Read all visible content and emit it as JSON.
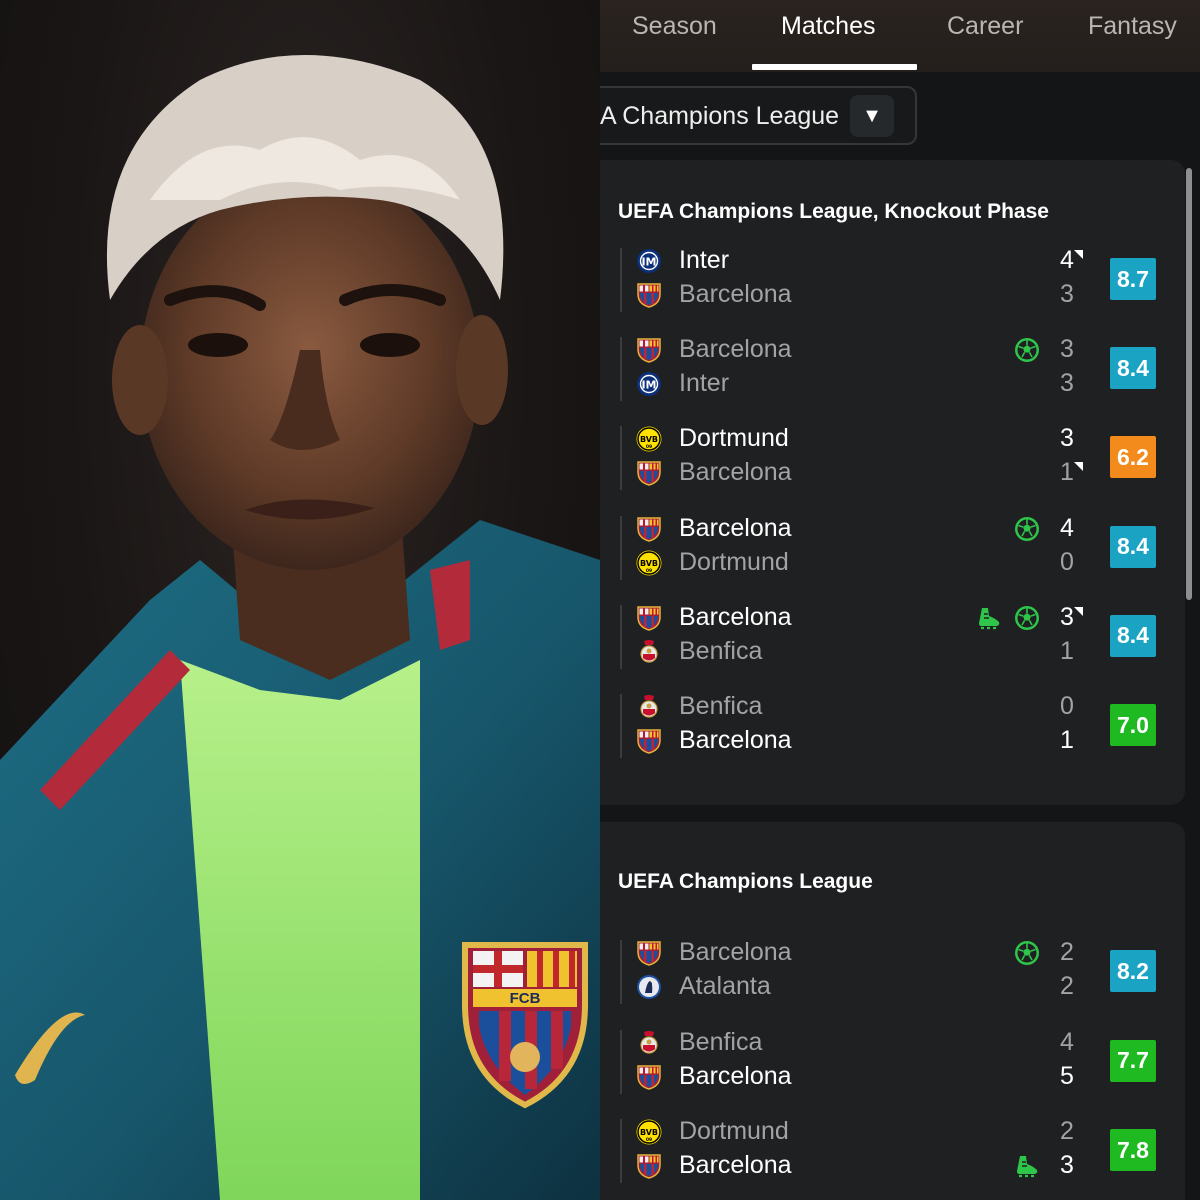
{
  "tabs": [
    {
      "label": "Season"
    },
    {
      "label": "Matches"
    },
    {
      "label": "Career"
    },
    {
      "label": "Fantasy"
    }
  ],
  "active_tab": "Matches",
  "league_select": {
    "value": "A Champions League"
  },
  "sections": [
    {
      "title": "UEFA Champions League, Knockout Phase",
      "matches": [
        {
          "home": {
            "name": "Inter",
            "logo": "inter-icon",
            "score": "4",
            "penalty_mark": true
          },
          "away": {
            "name": "Barcelona",
            "logo": "barcelona-icon",
            "score": "3"
          },
          "events": [],
          "rating": "8.7",
          "rating_color": "#1aa3c2"
        },
        {
          "home": {
            "name": "Barcelona",
            "logo": "barcelona-icon",
            "score": "3"
          },
          "away": {
            "name": "Inter",
            "logo": "inter-icon",
            "score": "3"
          },
          "events": [
            "goal-icon"
          ],
          "rating": "8.4",
          "rating_color": "#1aa3c2"
        },
        {
          "home": {
            "name": "Dortmund",
            "logo": "dortmund-icon",
            "score": "3"
          },
          "away": {
            "name": "Barcelona",
            "logo": "barcelona-icon",
            "score": "1",
            "penalty_mark": true
          },
          "events": [],
          "rating": "6.2",
          "rating_color": "#f28a1c"
        },
        {
          "home": {
            "name": "Barcelona",
            "logo": "barcelona-icon",
            "score": "4"
          },
          "away": {
            "name": "Dortmund",
            "logo": "dortmund-icon",
            "score": "0"
          },
          "events": [
            "goal-icon"
          ],
          "rating": "8.4",
          "rating_color": "#1aa3c2"
        },
        {
          "home": {
            "name": "Barcelona",
            "logo": "barcelona-icon",
            "score": "3",
            "penalty_mark": true
          },
          "away": {
            "name": "Benfica",
            "logo": "benfica-icon",
            "score": "1"
          },
          "events": [
            "assist-boot-icon",
            "goal-icon"
          ],
          "rating": "8.4",
          "rating_color": "#1aa3c2"
        },
        {
          "home": {
            "name": "Benfica",
            "logo": "benfica-icon",
            "score": "0"
          },
          "away": {
            "name": "Barcelona",
            "logo": "barcelona-icon",
            "score": "1"
          },
          "events": [],
          "rating": "7.0",
          "rating_color": "#1fba22"
        }
      ]
    },
    {
      "title": "UEFA Champions League",
      "matches": [
        {
          "home": {
            "name": "Barcelona",
            "logo": "barcelona-icon",
            "score": "2"
          },
          "away": {
            "name": "Atalanta",
            "logo": "atalanta-icon",
            "score": "2"
          },
          "events": [
            "goal-icon"
          ],
          "rating": "8.2",
          "rating_color": "#1aa3c2"
        },
        {
          "home": {
            "name": "Benfica",
            "logo": "benfica-icon",
            "score": "4"
          },
          "away": {
            "name": "Barcelona",
            "logo": "barcelona-icon",
            "score": "5"
          },
          "events": [],
          "rating": "7.7",
          "rating_color": "#1fba22"
        },
        {
          "home": {
            "name": "Dortmund",
            "logo": "dortmund-icon",
            "score": "2"
          },
          "away": {
            "name": "Barcelona",
            "logo": "barcelona-icon",
            "score": "3"
          },
          "events": [
            "assist-boot-icon"
          ],
          "rating": "7.8",
          "rating_color": "#1fba22"
        }
      ]
    }
  ],
  "photo": {
    "crest_text": "FCB"
  },
  "colors": {
    "accent_green": "#2fc44a",
    "rating_blue": "#1aa3c2",
    "rating_orange": "#f28a1c",
    "rating_green": "#1fba22"
  }
}
